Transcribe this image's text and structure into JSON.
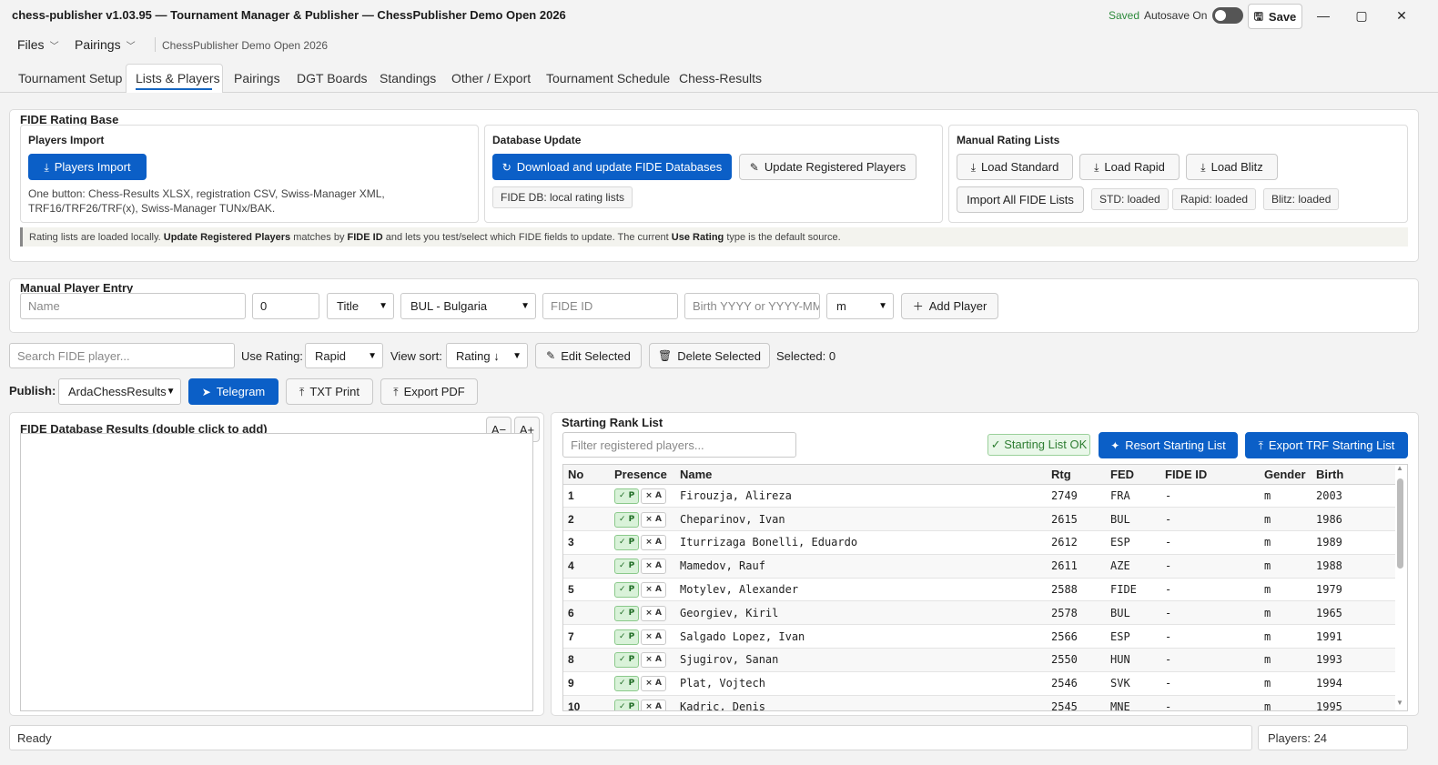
{
  "window": {
    "title": "chess-publisher v1.03.95 — Tournament Manager & Publisher — ChessPublisher Demo Open 2026",
    "saved_label": "Saved",
    "autosave_label": "Autosave On",
    "autosave_on": false,
    "save_label": "Save",
    "minimize": "—",
    "maximize": "▢",
    "close": "✕"
  },
  "menubar": {
    "files": "Files",
    "pairings": "Pairings",
    "tournament_name": "ChessPublisher Demo Open 2026"
  },
  "tabs": [
    {
      "label": "Tournament Setup",
      "active": false
    },
    {
      "label": "Lists & Players",
      "active": true
    },
    {
      "label": "Pairings",
      "active": false
    },
    {
      "label": "DGT Boards",
      "active": false
    },
    {
      "label": "Standings",
      "active": false
    },
    {
      "label": "Other / Export",
      "active": false
    },
    {
      "label": "Tournament Schedule",
      "active": false
    },
    {
      "label": "Chess-Results",
      "active": false
    }
  ],
  "fide_base": {
    "title": "FIDE Rating Base",
    "players_import": {
      "title": "Players Import",
      "button": "Players Import",
      "hint_line1": "One button: Chess-Results XLSX, registration CSV, Swiss-Manager XML,",
      "hint_line2": "TRF16/TRF26/TRF(x), Swiss-Manager TUNx/BAK."
    },
    "database_update": {
      "title": "Database Update",
      "download_button": "Download and update FIDE Databases",
      "update_button": "Update Registered Players",
      "status_chip": "FIDE DB: local rating lists"
    },
    "manual_lists": {
      "title": "Manual Rating Lists",
      "load_standard": "Load Standard",
      "load_rapid": "Load Rapid",
      "load_blitz": "Load Blitz",
      "import_all": "Import All FIDE Lists",
      "std_status": "STD: loaded",
      "rapid_status": "Rapid: loaded",
      "blitz_status": "Blitz: loaded"
    },
    "note": {
      "p1": "Rating lists are loaded locally.",
      "b1": "Update Registered Players",
      "p2": "matches by",
      "b2": "FIDE ID",
      "p3": "and lets you test/select which FIDE fields to update. The current",
      "b3": "Use Rating",
      "p4": "type is the default source."
    }
  },
  "manual_entry": {
    "title": "Manual Player Entry",
    "name_placeholder": "Name",
    "rating_value": "0",
    "title_select": "Title",
    "federation_select": "BUL - Bulgaria",
    "fide_id_placeholder": "FIDE ID",
    "birth_placeholder": "Birth YYYY or YYYY-MM-",
    "gender_select": "m",
    "add_button": "Add Player"
  },
  "toolbar": {
    "search_placeholder": "Search FIDE player...",
    "use_rating_label": "Use Rating:",
    "use_rating_value": "Rapid",
    "view_sort_label": "View sort:",
    "view_sort_value": "Rating ↓",
    "edit_selected": "Edit Selected",
    "delete_selected": "Delete Selected",
    "selected_count": "Selected: 0"
  },
  "publish": {
    "label": "Publish:",
    "target": "ArdaChessResults",
    "telegram": "Telegram",
    "txt_print": "TXT Print",
    "export_pdf": "Export PDF"
  },
  "fide_results": {
    "title": "FIDE Database Results (double click to add)",
    "zoom_out": "A−",
    "zoom_in": "A+"
  },
  "starting_list": {
    "title": "Starting Rank List",
    "filter_placeholder": "Filter registered players...",
    "ok_badge": "✓ Starting List OK",
    "resort_button": "Resort Starting List",
    "export_button": "Export TRF Starting List",
    "columns": [
      "No",
      "Presence",
      "Name",
      "Rtg",
      "FED",
      "FIDE ID",
      "Gender",
      "Birth"
    ],
    "present_label": "✓ P",
    "absent_label": "× A",
    "rows": [
      {
        "no": "1",
        "name": "Firouzja, Alireza",
        "rtg": "2749",
        "fed": "FRA",
        "fide_id": "-",
        "gender": "m",
        "birth": "2003"
      },
      {
        "no": "2",
        "name": "Cheparinov, Ivan",
        "rtg": "2615",
        "fed": "BUL",
        "fide_id": "-",
        "gender": "m",
        "birth": "1986"
      },
      {
        "no": "3",
        "name": "Iturrizaga Bonelli, Eduardo",
        "rtg": "2612",
        "fed": "ESP",
        "fide_id": "-",
        "gender": "m",
        "birth": "1989"
      },
      {
        "no": "4",
        "name": "Mamedov, Rauf",
        "rtg": "2611",
        "fed": "AZE",
        "fide_id": "-",
        "gender": "m",
        "birth": "1988"
      },
      {
        "no": "5",
        "name": "Motylev, Alexander",
        "rtg": "2588",
        "fed": "FIDE",
        "fide_id": "-",
        "gender": "m",
        "birth": "1979"
      },
      {
        "no": "6",
        "name": "Georgiev, Kiril",
        "rtg": "2578",
        "fed": "BUL",
        "fide_id": "-",
        "gender": "m",
        "birth": "1965"
      },
      {
        "no": "7",
        "name": "Salgado Lopez, Ivan",
        "rtg": "2566",
        "fed": "ESP",
        "fide_id": "-",
        "gender": "m",
        "birth": "1991"
      },
      {
        "no": "8",
        "name": "Sjugirov, Sanan",
        "rtg": "2550",
        "fed": "HUN",
        "fide_id": "-",
        "gender": "m",
        "birth": "1993"
      },
      {
        "no": "9",
        "name": "Plat, Vojtech",
        "rtg": "2546",
        "fed": "SVK",
        "fide_id": "-",
        "gender": "m",
        "birth": "1994"
      },
      {
        "no": "10",
        "name": "Kadric, Denis",
        "rtg": "2545",
        "fed": "MNE",
        "fide_id": "-",
        "gender": "m",
        "birth": "1995"
      }
    ]
  },
  "status": {
    "left": "Ready",
    "right": "Players: 24"
  }
}
